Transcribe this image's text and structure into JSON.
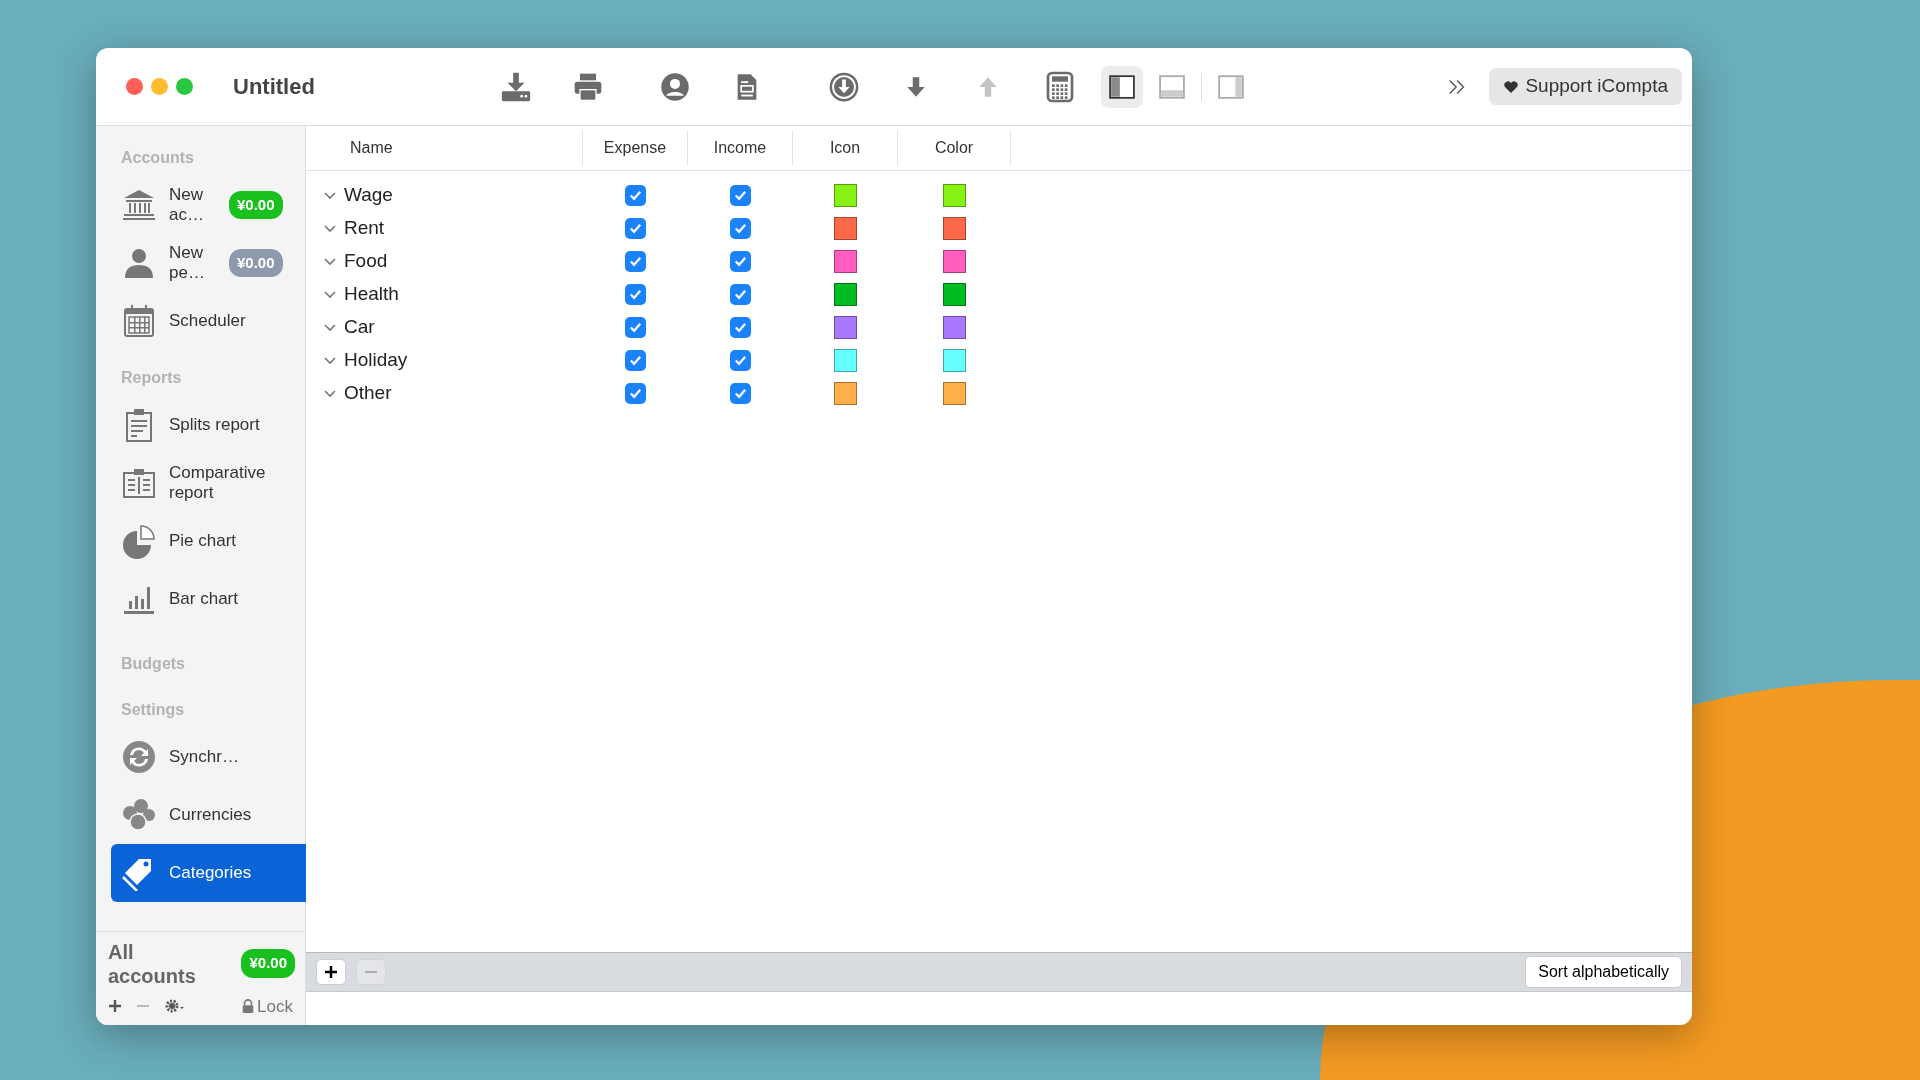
{
  "window": {
    "title": "Untitled"
  },
  "toolbar": {
    "groups": [
      [
        {
          "kind": "import",
          "disabled": false
        },
        {
          "kind": "print",
          "disabled": false
        }
      ],
      [
        {
          "kind": "person",
          "disabled": false
        },
        {
          "kind": "document",
          "disabled": false
        }
      ],
      [
        {
          "kind": "download-circle",
          "disabled": false
        },
        {
          "kind": "arrow-down",
          "disabled": false
        },
        {
          "kind": "arrow-up",
          "disabled": true
        },
        {
          "kind": "calculator",
          "disabled": false
        }
      ]
    ],
    "views": [
      {
        "kind": "sidebar-left",
        "selected": true
      },
      {
        "kind": "panel-bottom",
        "selected": false
      },
      {
        "kind": "sidebar-right",
        "selected": false
      }
    ],
    "support_button": {
      "label": "Support iCompta"
    }
  },
  "sidebar": {
    "sections": [
      {
        "title": "Accounts",
        "items": [
          {
            "label": "New ac…",
            "kind": "bank",
            "badge": "¥0.00",
            "color": "#19c01e",
            "selected": false
          },
          {
            "label": "New pe…",
            "kind": "person",
            "badge": "¥0.00",
            "color": "#8e9aab",
            "selected": false
          },
          {
            "label": "Scheduler",
            "kind": "calendar",
            "selected": false
          }
        ]
      },
      {
        "title": "Reports",
        "items": [
          {
            "label": "Splits report",
            "kind": "clipboard",
            "selected": false
          },
          {
            "label": "Comparative report",
            "kind": "clipboard-columns",
            "selected": false
          },
          {
            "label": "Pie chart",
            "kind": "pie",
            "selected": false
          },
          {
            "label": "Bar chart",
            "kind": "bars",
            "selected": false
          }
        ]
      },
      {
        "title": "Budgets"
      },
      {
        "title": "Settings",
        "items": [
          {
            "label": "Synchr…",
            "kind": "sync",
            "selected": false
          },
          {
            "label": "Currencies",
            "kind": "coins",
            "selected": false
          },
          {
            "label": "Categories",
            "kind": "tag",
            "selected": true
          }
        ]
      }
    ],
    "total": {
      "label": "All accounts",
      "badge": "¥0.00"
    },
    "footer": {
      "buttons": [
        {
          "kind": "add",
          "disabled": false
        },
        {
          "kind": "remove",
          "disabled": true
        },
        {
          "kind": "gear",
          "disabled": false
        }
      ],
      "lock": "Lock"
    }
  },
  "table": {
    "columns": [
      "Name",
      "Expense",
      "Income",
      "Icon",
      "Color"
    ],
    "rows": [
      {
        "name": "Wage",
        "expanded": true,
        "expense": true,
        "income": true,
        "color": "#88f214"
      },
      {
        "name": "Rent",
        "expanded": true,
        "expense": true,
        "income": true,
        "color": "#fd6a4a"
      },
      {
        "name": "Food",
        "expanded": true,
        "expense": true,
        "income": true,
        "color": "#ff5ebf"
      },
      {
        "name": "Health",
        "expanded": true,
        "expense": true,
        "income": true,
        "color": "#00bb22"
      },
      {
        "name": "Car",
        "expanded": true,
        "expense": true,
        "income": true,
        "color": "#aa77ff"
      },
      {
        "name": "Holiday",
        "expanded": true,
        "expense": true,
        "income": true,
        "color": "#66ffff"
      },
      {
        "name": "Other",
        "expanded": true,
        "expense": true,
        "income": true,
        "color": "#ffb04a"
      }
    ]
  },
  "bottom_bar": {
    "buttons": [
      {
        "kind": "add",
        "disabled": false
      },
      {
        "kind": "remove",
        "disabled": true
      }
    ],
    "sort_button": "Sort alphabetically"
  }
}
